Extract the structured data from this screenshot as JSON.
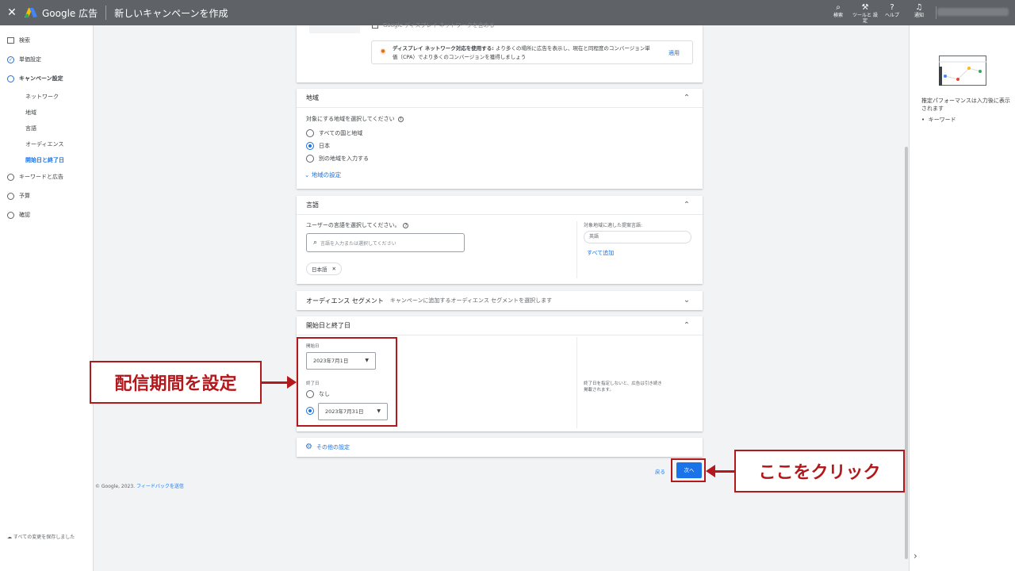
{
  "topbar": {
    "close": "✕",
    "brand": "Google 広告",
    "title": "新しいキャンペーンを作成",
    "tools": [
      {
        "icon": "search-icon",
        "glyph": "⌕",
        "label": "検索"
      },
      {
        "icon": "wrench-icon",
        "glyph": "⚒",
        "label": "ツールと 設定"
      },
      {
        "icon": "help-icon",
        "glyph": "?",
        "label": "ヘルプ"
      },
      {
        "icon": "bell-icon",
        "glyph": "🔔",
        "label": "通知"
      }
    ]
  },
  "sidebar": {
    "items": [
      {
        "label": "検索",
        "state": "done"
      },
      {
        "label": "単価設定",
        "state": "check"
      },
      {
        "label": "キャンペーン設定",
        "state": "active"
      },
      {
        "label": "キーワードと広告",
        "state": "todo"
      },
      {
        "label": "予算",
        "state": "todo"
      },
      {
        "label": "確認",
        "state": "todo"
      }
    ],
    "subitems": [
      "ネットワーク",
      "地域",
      "言語",
      "オーディエンス",
      "開始日と終了日"
    ],
    "saved": "すべての変更を保存しました"
  },
  "network": {
    "checkbox_label": "Google ディスプレイ ネットワークを含める",
    "display_bold": "ディスプレイ ネットワーク対応を使用する:",
    "display_text": "より多くの場所に広告を表示し、現在と同程度のコンバージョン単価（CPA）でより多くのコンバージョンを獲得しましょう",
    "apply": "適用"
  },
  "region": {
    "title": "地域",
    "prompt": "対象にする地域を選択してください",
    "options": [
      "すべての国と地域",
      "日本",
      "別の地域を入力する"
    ],
    "selected": 1,
    "link": "地域の設定"
  },
  "language": {
    "title": "言語",
    "prompt": "ユーザーの言語を選択してください。",
    "placeholder": "言語を入力または選択してください",
    "chip": "日本語",
    "suggest_label": "対象地域に適した提案言語:",
    "suggest_chip": "英語",
    "add_all": "すべて追加"
  },
  "audience": {
    "title": "オーディエンス セグメント",
    "desc": "キャンペーンに追加するオーディエンス セグメントを選択します"
  },
  "dates": {
    "title": "開始日と終了日",
    "start_label": "開始日",
    "start_value": "2023年7月1日",
    "end_label": "終了日",
    "end_none": "なし",
    "end_value": "2023年7月31日",
    "note": "終了日を指定しないと、広告は引き続き掲載されます。"
  },
  "other": {
    "label": "その他の設定"
  },
  "footer": {
    "back": "戻る",
    "next": "次へ",
    "copyright": "© Google, 2023.",
    "feedback": "フィードバックを送信"
  },
  "rightpanel": {
    "text": "推定パフォーマンスは入力後に表示されます",
    "bullet": "キーワード"
  },
  "annotations": {
    "period": "配信期間を設定",
    "click": "ここをクリック"
  },
  "colors": {
    "accent": "#1a73e8",
    "annotation": "#b3191c",
    "topbar": "#5f6368"
  }
}
